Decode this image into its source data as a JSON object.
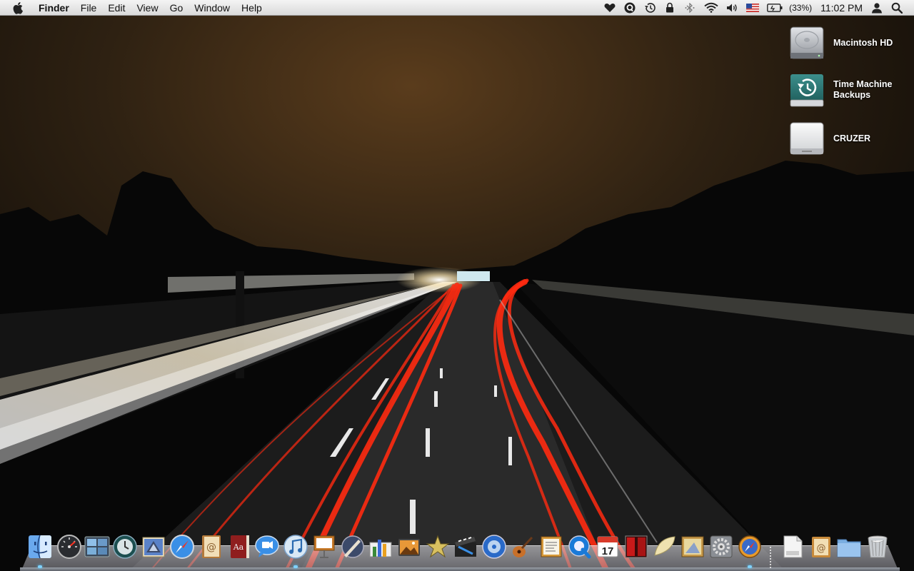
{
  "menubar": {
    "app_name": "Finder",
    "menus": [
      "File",
      "Edit",
      "View",
      "Go",
      "Window",
      "Help"
    ],
    "battery_percent": "(33%)",
    "clock": "11:02 PM"
  },
  "desktop": {
    "icons": [
      {
        "label": "Macintosh HD"
      },
      {
        "label": "Time Machine Backups"
      },
      {
        "label": "CRUZER"
      }
    ]
  },
  "colors": {
    "menubar_top": "#f4f4f4",
    "menubar_bottom": "#dadada",
    "sky_glow": "#5a3c1c",
    "light_trail_red": "#ff2a10",
    "light_trail_white": "#fff6dc"
  },
  "dock": {
    "apps": [
      {
        "name": "finder-icon"
      },
      {
        "name": "dashboard-icon"
      },
      {
        "name": "spaces-icon"
      },
      {
        "name": "time-machine-icon"
      },
      {
        "name": "mail-icon"
      },
      {
        "name": "safari-icon"
      },
      {
        "name": "address-book-icon"
      },
      {
        "name": "dictionary-icon"
      },
      {
        "name": "ichat-icon"
      },
      {
        "name": "itunes-icon"
      },
      {
        "name": "keynote-icon"
      },
      {
        "name": "aperture-icon"
      },
      {
        "name": "numbers-icon"
      },
      {
        "name": "iphoto-icon"
      },
      {
        "name": "imovie-icon"
      },
      {
        "name": "final-cut-icon"
      },
      {
        "name": "dvd-player-icon"
      },
      {
        "name": "garageband-icon"
      },
      {
        "name": "pages-app-icon"
      },
      {
        "name": "quicktime-icon"
      },
      {
        "name": "ical-icon"
      },
      {
        "name": "front-row-icon"
      },
      {
        "name": "tortilla-icon"
      },
      {
        "name": "preview-icon"
      },
      {
        "name": "system-preferences-icon"
      },
      {
        "name": "compass-icon"
      }
    ],
    "stacks": [
      {
        "name": "pages-document-icon"
      },
      {
        "name": "mail-stack-icon"
      },
      {
        "name": "folder-icon"
      },
      {
        "name": "trash-icon"
      }
    ]
  }
}
